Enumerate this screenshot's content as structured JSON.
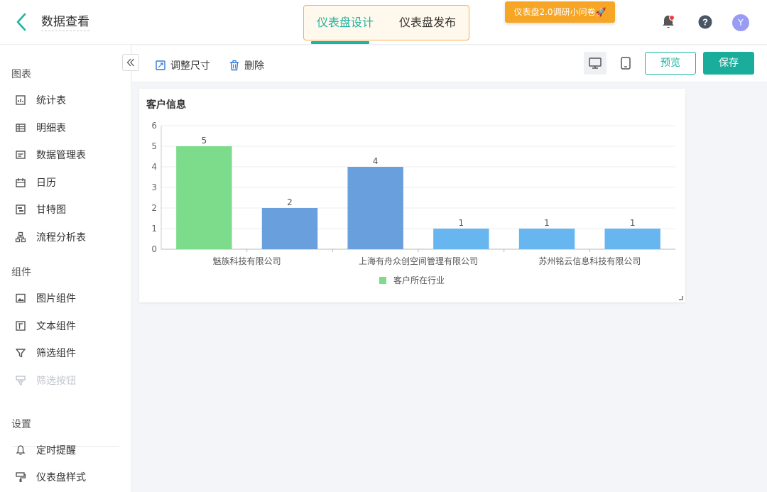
{
  "header": {
    "title": "数据查看",
    "tabs": [
      {
        "label": "仪表盘设计",
        "active": true
      },
      {
        "label": "仪表盘发布",
        "active": false
      }
    ],
    "survey_badge": "仪表盘2.0调研小问卷🚀",
    "avatar_initial": "Y",
    "accent_color": "#20b2a0"
  },
  "sidebar": {
    "sections": [
      {
        "title": "图表",
        "items": [
          {
            "label": "统计表",
            "icon": "stat-table-icon"
          },
          {
            "label": "明细表",
            "icon": "detail-table-icon"
          },
          {
            "label": "数据管理表",
            "icon": "data-manage-icon"
          },
          {
            "label": "日历",
            "icon": "calendar-icon"
          },
          {
            "label": "甘特图",
            "icon": "gantt-icon"
          },
          {
            "label": "流程分析表",
            "icon": "flow-icon"
          }
        ]
      },
      {
        "title": "组件",
        "items": [
          {
            "label": "图片组件",
            "icon": "image-icon"
          },
          {
            "label": "文本组件",
            "icon": "text-icon"
          },
          {
            "label": "筛选组件",
            "icon": "filter-icon"
          },
          {
            "label": "筛选按钮",
            "icon": "filter-button-icon",
            "disabled": true
          }
        ]
      },
      {
        "title": "设置",
        "items": [
          {
            "label": "定时提醒",
            "icon": "reminder-icon"
          },
          {
            "label": "仪表盘样式",
            "icon": "style-icon"
          }
        ]
      }
    ]
  },
  "toolbar": {
    "resize_label": "调整尺寸",
    "delete_label": "删除",
    "preview_label": "预览",
    "save_label": "保存"
  },
  "card": {
    "title": "客户信息"
  },
  "chart_data": {
    "type": "bar",
    "title": "",
    "categories": [
      "魅族科技有限公司",
      "",
      "上海有舟众创空间管理有限公司",
      "",
      "苏州铭云信息科技有限公司",
      ""
    ],
    "series": [
      {
        "name": "客户所在行业",
        "values": [
          5,
          2,
          4,
          1,
          1,
          1
        ]
      }
    ],
    "ylim": [
      0,
      6
    ],
    "yticks": [
      0,
      1,
      2,
      3,
      4,
      5,
      6
    ],
    "grid": true,
    "legend": "bottom",
    "colors": [
      "#7ddc8c",
      "#6a9fdd",
      "#6a9fdd",
      "#68b6f0",
      "#68b6f0",
      "#68b6f0"
    ],
    "legend_color": "#7ddc8c"
  }
}
